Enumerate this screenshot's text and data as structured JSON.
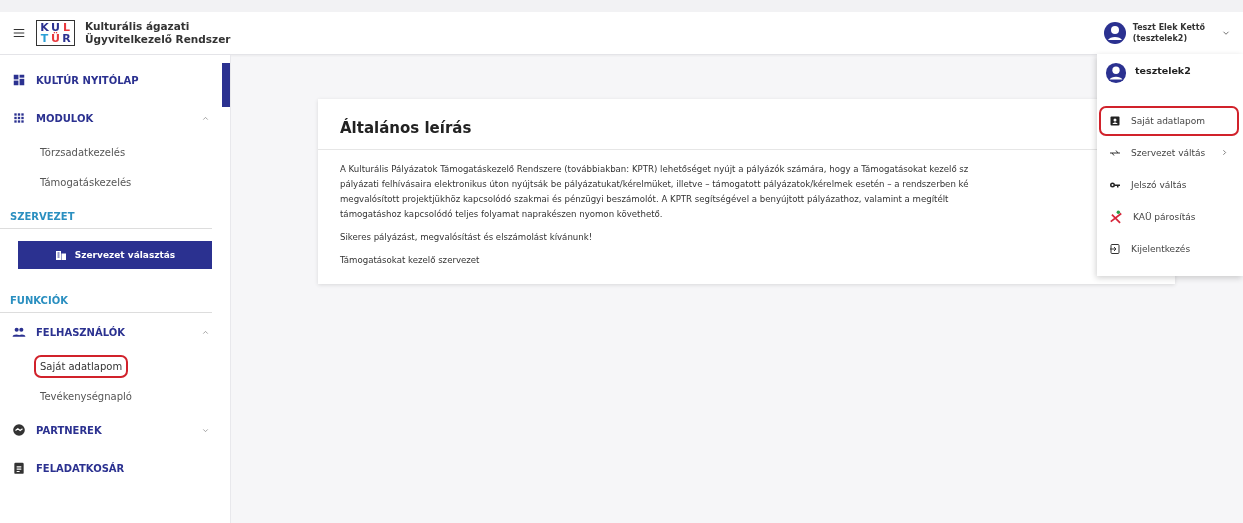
{
  "header": {
    "logo": {
      "top": [
        "K",
        "U",
        "L"
      ],
      "bottom": [
        "T",
        "Ü",
        "R"
      ]
    },
    "app_title_1": "Kulturális ágazati",
    "app_title_2": "Ügyvitelkezelő Rendszer",
    "user": {
      "name": "Teszt Elek Kettő",
      "login": "(tesztelek2)"
    }
  },
  "sidebar": {
    "items": [
      {
        "kind": "nav",
        "label": "KULTÚR NYITÓLAP"
      },
      {
        "kind": "group",
        "label": "MODULOK",
        "expanded": true,
        "children": [
          {
            "label": "Törzsadatkezelés",
            "highlighted": false
          },
          {
            "label": "Támogatáskezelés",
            "highlighted": false
          }
        ]
      },
      {
        "kind": "section",
        "label": "SZERVEZET"
      },
      {
        "kind": "button",
        "label": "Szervezet választás"
      },
      {
        "kind": "section",
        "label": "FUNKCIÓK"
      },
      {
        "kind": "group",
        "label": "FELHASZNÁLÓK",
        "expanded": true,
        "children": [
          {
            "label": "Saját adatlapom",
            "highlighted": true
          },
          {
            "label": "Tevékenységnapló",
            "highlighted": false
          }
        ]
      },
      {
        "kind": "group",
        "label": "PARTNEREK",
        "expanded": false
      },
      {
        "kind": "nav",
        "label": "FELADATKOSÁR"
      }
    ]
  },
  "card": {
    "title": "Általános leírás",
    "paragraphs": [
      [
        "A Kulturális Pályázatok Támogatáskezelő Rendszere (továbbiakban: KPTR) lehetőséget nyújt a pályázók számára, hogy a Támogatásokat kezelő sz",
        "pályázati felhívásaira elektronikus úton nyújtsák be pályázatukat/kérelmüket, illetve – támogatott pályázatok/kérelmek esetén – a rendszerben ké",
        "megvalósított projektjükhöz kapcsolódó szakmai és pénzügyi beszámolót. A KPTR segítségével a benyújtott pályázathoz, valamint a megítélt",
        "támogatáshoz kapcsolódó teljes folyamat naprakészen nyomon követhető."
      ],
      [
        "Sikeres pályázást, megvalósítást és elszámolást kívánunk!"
      ],
      [
        "Támogatásokat kezelő szervezet"
      ]
    ]
  },
  "user_menu": {
    "username": "tesztelek2",
    "items": [
      {
        "label": "Saját adatlapom",
        "highlighted": true,
        "submenu": false
      },
      {
        "label": "Szervezet váltás",
        "highlighted": false,
        "submenu": true
      },
      {
        "label": "Jelszó váltás",
        "highlighted": false,
        "submenu": false
      },
      {
        "label": "KAÜ párosítás",
        "highlighted": false,
        "submenu": false
      },
      {
        "label": "Kijelentkezés",
        "highlighted": false,
        "submenu": false
      }
    ]
  }
}
